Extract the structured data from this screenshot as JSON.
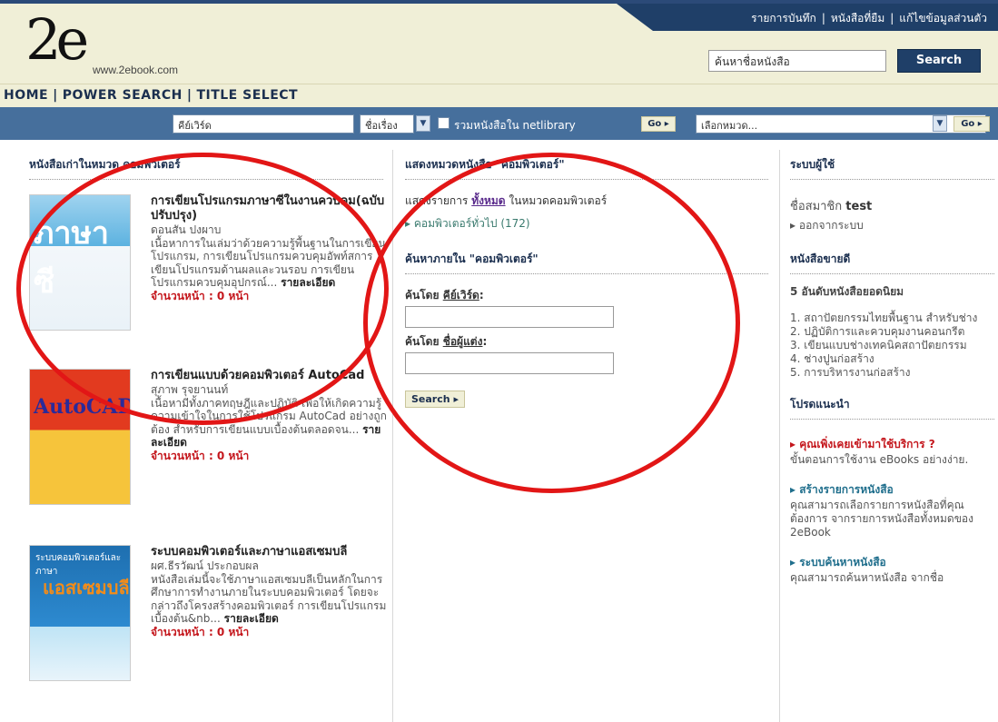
{
  "header": {
    "logo_mark": "2e",
    "logo_url": "www.2ebook.com",
    "top_links": [
      "รายการบันทึก",
      "หนังสือที่ยืม",
      "แก้ไขข้อมูลส่วนตัว"
    ],
    "search_placeholder": "ค้นหาชื่อหนังสือ",
    "search_button": "Search"
  },
  "main_nav": [
    "HOME",
    "POWER SEARCH",
    "TITLE SELECT"
  ],
  "search_bar": {
    "keyword_placeholder": "คีย์เวิร์ด",
    "field_select": "ชื่อเรื่อง",
    "include_netlibrary_label": "รวมหนังสือใน netlibrary",
    "go1": "Go",
    "category_placeholder": "เลือกหมวด...",
    "go2": "Go"
  },
  "left_column": {
    "title": "หนังสือเก่าในหมวด คอมพิวเตอร์",
    "books": [
      {
        "title": "การเขียนโปรแกรมภาษาซีในงานควบคุม(ฉบับปรับปรุง)",
        "author": "ดอนสัน ปงผาบ",
        "desc": "เนื้อหาการในเล่มว่าด้วยความรู้พื้นฐานในการเขียนโปรแกรม, การเขียนโปรแกรมควบคุมอัพท์สการเขียนโปรแกรมด้านผลและวนรอบ การเขียนโปรแกรมควบคุมอุปกรณ์...",
        "detail": "รายละเอียด",
        "pages": "จำนวนหน้า : 0 หน้า",
        "cover_text": "ภาษาซี"
      },
      {
        "title": "การเขียนแบบด้วยคอมพิวเตอร์ AutoCad",
        "author": "สุภาพ รุจยานนท์",
        "desc": "เนื้อหามีทั้งภาคทฤษฎีและปฏิบัติ เพื่อให้เกิดความรู้ความเข้าใจในการใช้โปรแกรม AutoCad อย่างถูกต้อง สำหรับการเขียนแบบเบื้องต้นตลอดจน...",
        "detail": "รายละเอียด",
        "pages": "จำนวนหน้า : 0 หน้า",
        "cover_text": "AutoCAD"
      },
      {
        "title": "ระบบคอมพิวเตอร์และภาษาแอสเซมบลี",
        "author": "ผศ.ธีรวัฒน์ ประกอบผล",
        "desc": "หนังสือเล่มนี้จะใช้ภาษาแอสเซมบลีเป็นหลักในการศึกษาการทำงานภายในระบบคอมพิวเตอร์ โดยจะกล่าวถึงโครงสร้างคอมพิวเตอร์ การเขียนโปรแกรมเบื้องต้น&nb...",
        "detail": "รายละเอียด",
        "pages": "จำนวนหน้า : 0 หน้า",
        "cover_text": "แอสเซมบลี",
        "cover_small": "ระบบคอมพิวเตอร์และภาษา"
      }
    ]
  },
  "middle_column": {
    "title": "แสดงหมวดหนังสือ \"คอมพิวเตอร์\"",
    "show_list_prefix": "แสดงรายการ",
    "show_all": "ทั้งหมด",
    "show_list_suffix": "ในหมวดคอมพิวเตอร์",
    "subcategory": "คอมพิวเตอร์ทั่วไป (172)",
    "search_in_title": "ค้นหาภายใน \"คอมพิวเตอร์\"",
    "by_keyword_prefix": "ค้นโดย",
    "by_keyword": "คีย์เวิร์ด",
    "by_author_prefix": "ค้นโดย",
    "by_author": "ชื่อผู้แต่ง",
    "search_button": "Search"
  },
  "right_column": {
    "user_title": "ระบบผู้ใช้",
    "member_label": "ชื่อสมาชิก",
    "member_name": "test",
    "logout": "ออกจากระบบ",
    "bestseller_title": "หนังสือขายดี",
    "top5": "5 อันดับหนังสือยอดนิยม",
    "top_list": [
      "1. สถาปัตยกรรมไทยพื้นฐาน สำหรับช่าง",
      "2. ปฏิบัติการและควบคุมงานคอนกรีต",
      "3. เขียนแบบช่างเทคนิคสถาปัตยกรรม",
      "4. ช่างปูนก่อสร้าง",
      "5. การบริหารงานก่อสร้าง"
    ],
    "recommend_title": "โปรดแนะนำ",
    "rec1_title": "คุณเพิ่งเคยเข้ามาใช้บริการ ?",
    "rec1_text": "ขั้นตอนการใช้งาน eBooks อย่างง่าย.",
    "rec2_title": "สร้างรายการหนังสือ",
    "rec2_text": "คุณสามารถเลือกรายการหนังสือที่คุณต้องการ จากรายการหนังสือทั้งหมดของ 2eBook",
    "rec3_title": "ระบบค้นหาหนังสือ",
    "rec3_text": "คุณสามารถค้นหาหนังสือ จากชื่อ"
  }
}
